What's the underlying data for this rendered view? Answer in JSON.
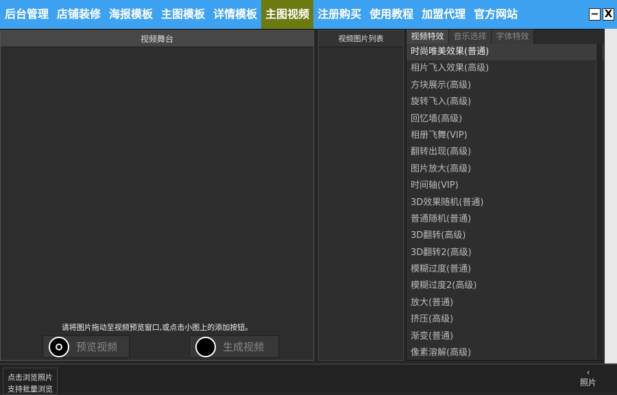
{
  "nav": [
    "后台管理",
    "店铺装修",
    "海报模板",
    "主图模板",
    "详情模板",
    "主图视频",
    "注册购买",
    "使用教程",
    "加盟代理",
    "官方网站"
  ],
  "active_nav": 5,
  "window": {
    "minimize": "−",
    "close": "X"
  },
  "stage": {
    "title": "视频舞台",
    "hint": "请将图片拖动至视频预览窗口,或点击小图上的添加按钮。",
    "preview": "预览视频",
    "generate": "生成视频"
  },
  "imglist": {
    "title": "视频图片列表"
  },
  "effects": {
    "tabs": [
      "视频特效",
      "音乐选择",
      "字体特效"
    ],
    "items": [
      "时尚唯美效果(普通)",
      "相片飞入效果(高级)",
      "方块展示(高级)",
      "旋转飞入(高级)",
      "回忆墙(高级)",
      "相册飞舞(VIP)",
      "翻转出现(高级)",
      "图片放大(高级)",
      "时间轴(VIP)",
      "3D效果随机(普通)",
      "普通随机(普通)",
      "3D翻转(高级)",
      "3D翻转2(高级)",
      "模糊过度(普通)",
      "模糊过度2(高级)",
      "放大(普通)",
      "挤压(高级)",
      "渐变(普通)",
      "像素溶解(高级)"
    ]
  },
  "bottom": {
    "browse1": "点击浏览照片",
    "browse2": "支持批量浏览",
    "side_arrow": "‹",
    "side_text": "照片"
  }
}
